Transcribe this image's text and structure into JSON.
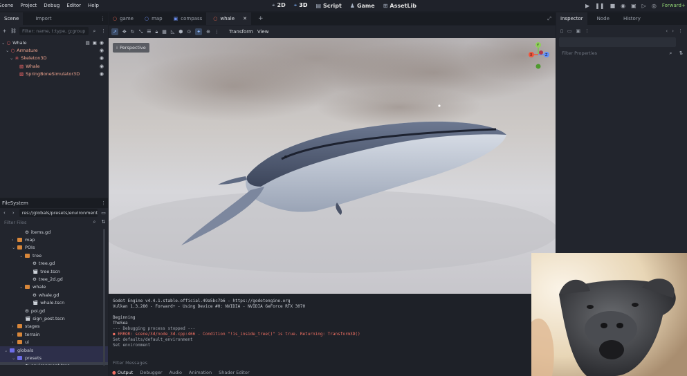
{
  "menu": [
    "Scene",
    "Project",
    "Debug",
    "Editor",
    "Help"
  ],
  "modes": [
    {
      "label": "2D",
      "icon": "2d-icon"
    },
    {
      "label": "3D",
      "icon": "3d-icon",
      "active": true
    },
    {
      "label": "Script",
      "icon": "script-icon"
    },
    {
      "label": "Game",
      "icon": "game-icon"
    },
    {
      "label": "AssetLib",
      "icon": "assetlib-icon"
    }
  ],
  "renderer": "Forward+",
  "left_dock": {
    "tabs": [
      "Scene",
      "Import"
    ],
    "filter_placeholder": "Filter: name, t:type, g:group",
    "tree": [
      {
        "label": "Whale",
        "indent": 0
      },
      {
        "label": "Armature",
        "indent": 1
      },
      {
        "label": "Skeleton3D",
        "indent": 2
      },
      {
        "label": "Whale",
        "indent": 3
      },
      {
        "label": "SpringBoneSimulator3D",
        "indent": 3
      }
    ]
  },
  "filesystem": {
    "title": "FileSystem",
    "path": "res://globals/presets/environment",
    "filter_placeholder": "Filter Files",
    "items": [
      {
        "label": "items.gd",
        "kind": "script",
        "indent": 2
      },
      {
        "label": "map",
        "kind": "folder",
        "indent": 1
      },
      {
        "label": "POIs",
        "kind": "folder",
        "indent": 1
      },
      {
        "label": "tree",
        "kind": "folder",
        "indent": 2
      },
      {
        "label": "tree.gd",
        "kind": "script",
        "indent": 3
      },
      {
        "label": "tree.tscn",
        "kind": "scene",
        "indent": 3
      },
      {
        "label": "tree_2d.gd",
        "kind": "script",
        "indent": 3
      },
      {
        "label": "whale",
        "kind": "folder",
        "indent": 2
      },
      {
        "label": "whale.gd",
        "kind": "script",
        "indent": 3
      },
      {
        "label": "whale.tscn",
        "kind": "scene",
        "indent": 3
      },
      {
        "label": "poi.gd",
        "kind": "script",
        "indent": 2
      },
      {
        "label": "sign_post.tscn",
        "kind": "scene",
        "indent": 2
      },
      {
        "label": "stages",
        "kind": "folder",
        "indent": 1
      },
      {
        "label": "terrain",
        "kind": "folder",
        "indent": 1
      },
      {
        "label": "ui",
        "kind": "folder",
        "indent": 1
      },
      {
        "label": "globals",
        "kind": "folder-blue",
        "indent": 0
      },
      {
        "label": "presets",
        "kind": "folder-blue",
        "indent": 1
      },
      {
        "label": "environment.tres",
        "kind": "resource",
        "indent": 2
      }
    ]
  },
  "editor_tabs": [
    {
      "label": "game",
      "dot": "#e0614c"
    },
    {
      "label": "map",
      "dot": "#6b8ef0"
    },
    {
      "label": "compass",
      "dot": "#6b8ef0"
    },
    {
      "label": "whale",
      "dot": "#e0614c",
      "active": true
    }
  ],
  "toolbar": {
    "transform": "Transform",
    "view": "View"
  },
  "viewport": {
    "perspective_label": "Perspective"
  },
  "gizmo": {
    "y": "Y",
    "x": "X",
    "z": "Z"
  },
  "console": {
    "lines": [
      {
        "text": "Godot Engine v4.4.1.stable.official.49a5bc7b6 - https://godotengine.org",
        "color": "#c8ccd3"
      },
      {
        "text": "Vulkan 1.3.280 - Forward+ - Using Device #0: NVIDIA - NVIDIA GeForce RTX 3070",
        "color": "#c8ccd3"
      },
      {
        "text": "",
        "color": "#c8ccd3"
      },
      {
        "text": "Beginning",
        "color": "#c8ccd3"
      },
      {
        "text": "TheSea",
        "color": "#c8ccd3"
      },
      {
        "text": "--- Debugging process stopped ---",
        "color": "#a2a7b0"
      },
      {
        "text": "● ERROR: scene/3d/node_3d.cpp:466 - Condition \"!is_inside_tree()\" is true. Returning: Transform3D()",
        "color": "#f07063"
      },
      {
        "text": "Set defaults/default_environment",
        "color": "#a2a7b0"
      },
      {
        "text": "Set environment",
        "color": "#a2a7b0"
      }
    ],
    "filter_placeholder": "Filter Messages",
    "bottom_tabs": [
      "Output",
      "Debugger",
      "Audio",
      "Animation",
      "Shader Editor"
    ],
    "version": "4.4.1.stable"
  },
  "inspector": {
    "tabs": [
      "Inspector",
      "Node",
      "History"
    ],
    "filter_placeholder": "Filter Properties"
  }
}
